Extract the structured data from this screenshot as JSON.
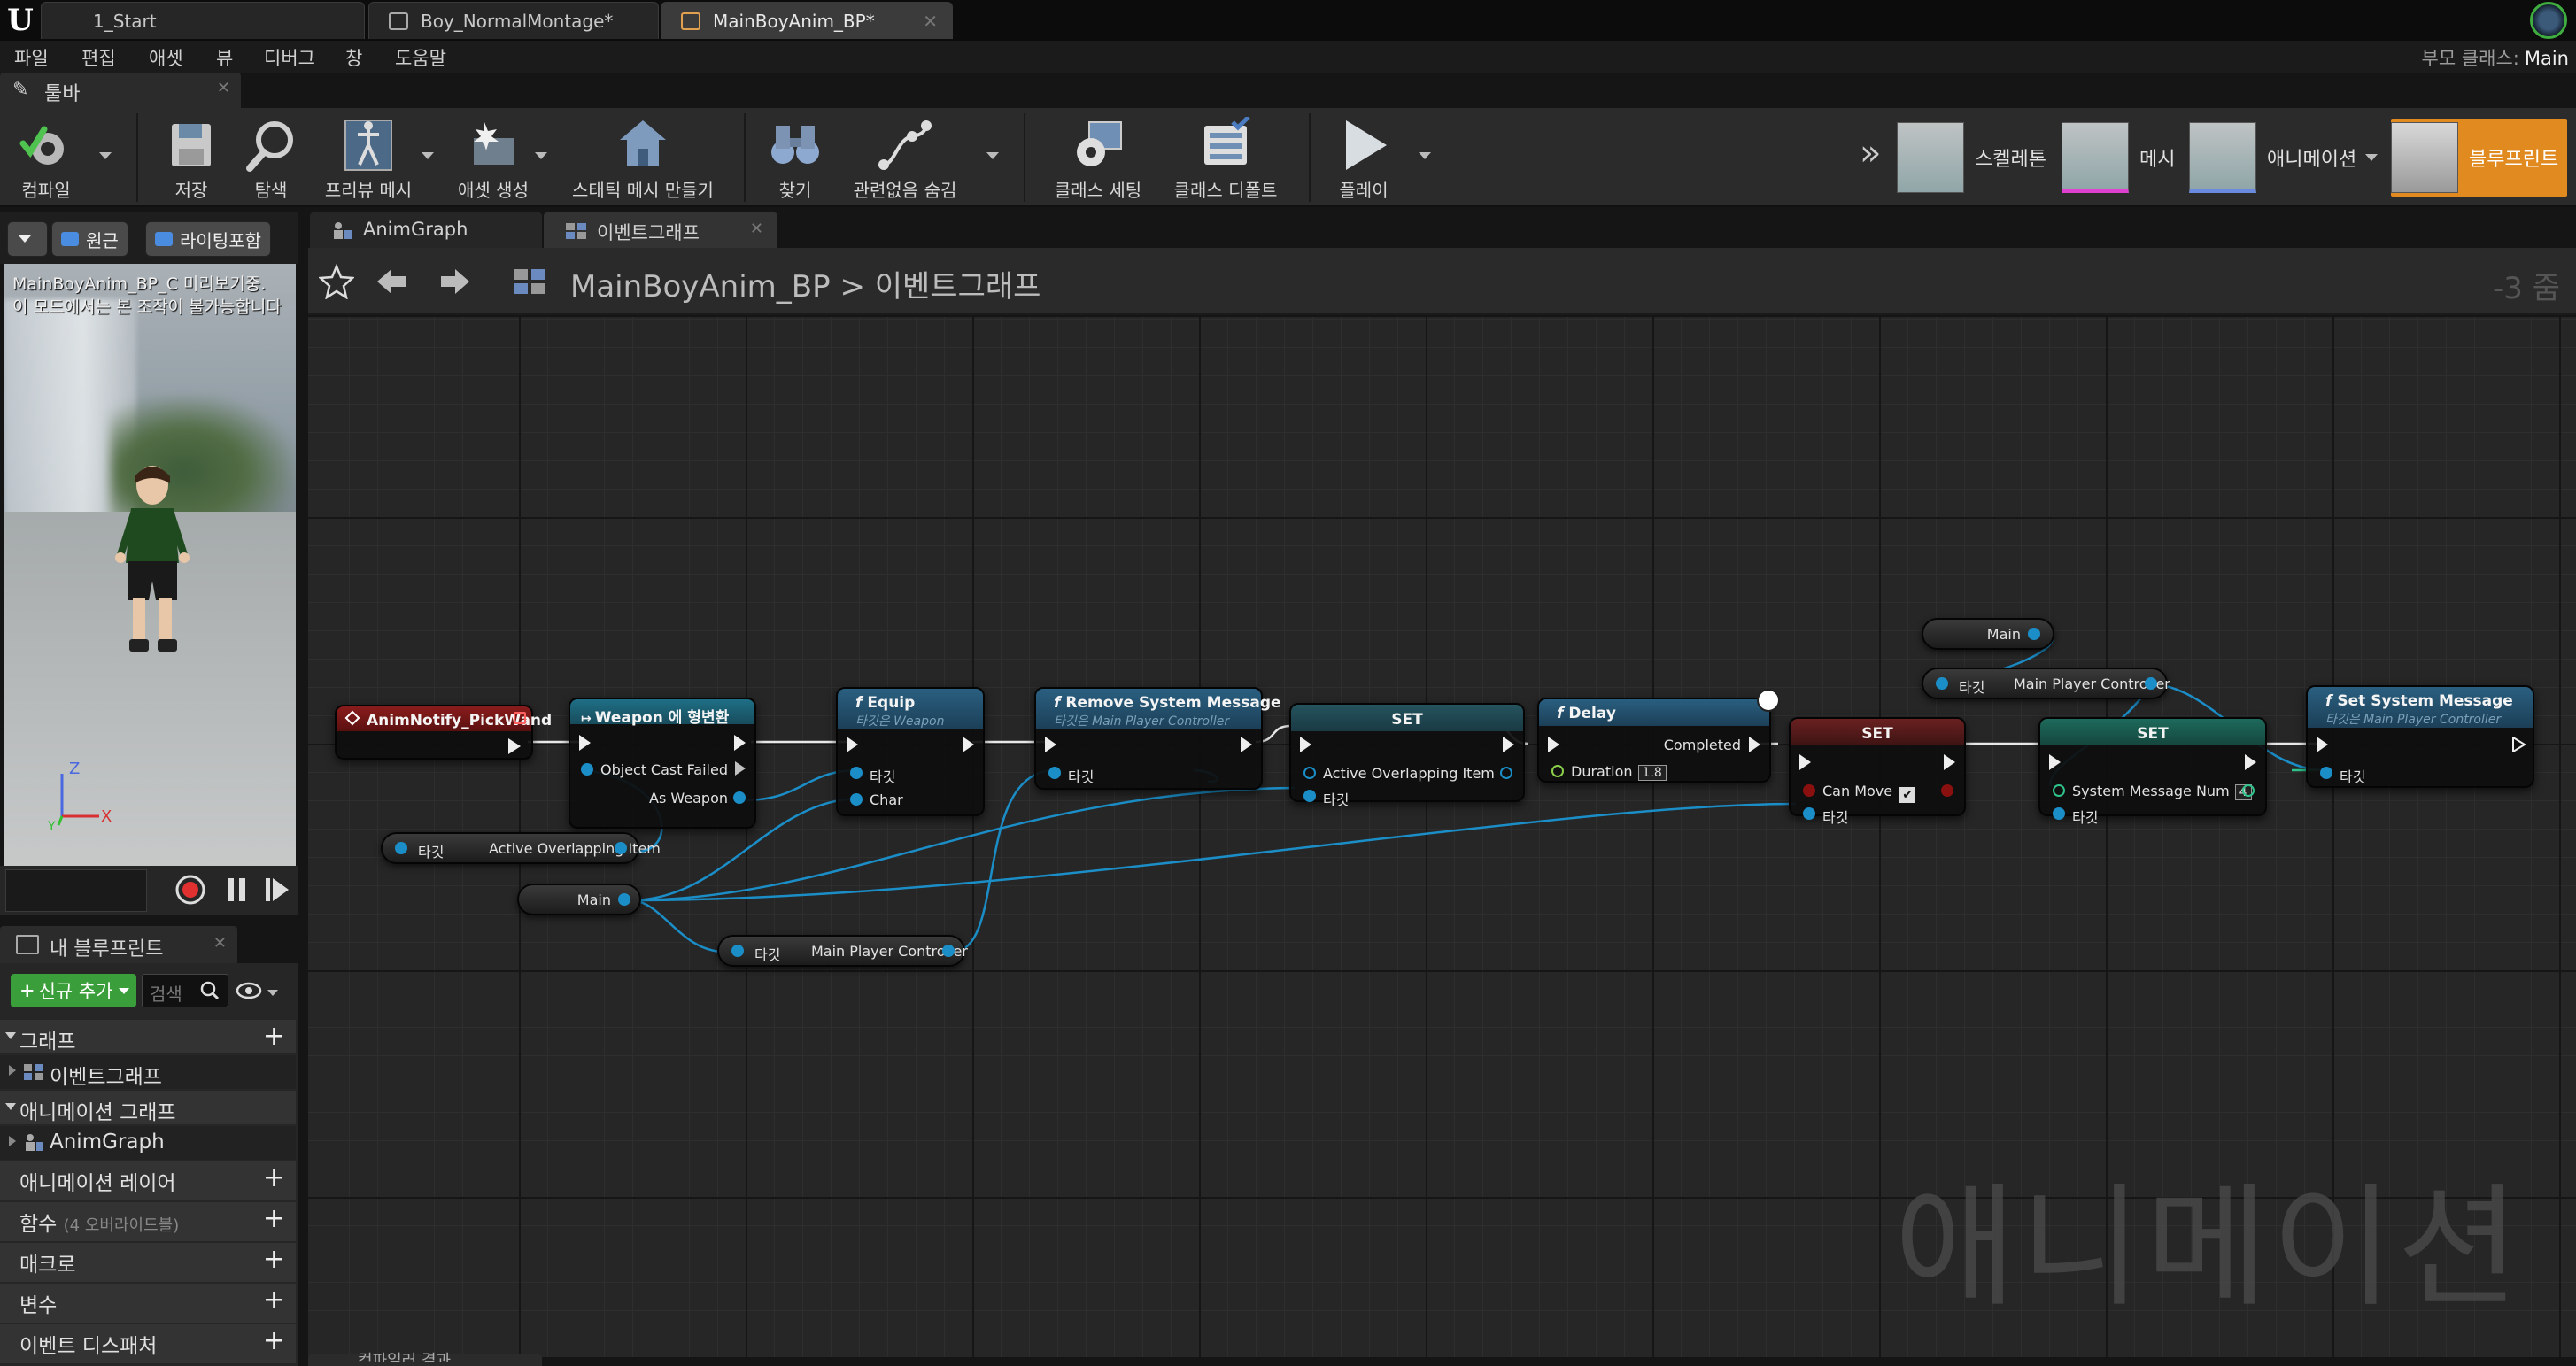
{
  "app": {
    "tabs": [
      {
        "label": "1_Start"
      },
      {
        "label": "Boy_NormalMontage*"
      },
      {
        "label": "MainBoyAnim_BP*"
      }
    ],
    "logo_text": "U"
  },
  "menu": {
    "items": [
      "파일",
      "편집",
      "애셋",
      "뷰",
      "디버그",
      "창",
      "도움말"
    ],
    "parent_class_label": "부모 클래스:",
    "parent_class_value": "Main"
  },
  "toolbar": {
    "tab_label": "툴바",
    "buttons": {
      "compile": "컴파일",
      "save": "저장",
      "browse": "탐색",
      "preview_mesh": "프리뷰 메시",
      "create_asset": "애셋 생성",
      "static_mesh": "스태틱 메시 만들기",
      "find": "찾기",
      "hide_unrelated": "관련없음 숨김",
      "class_settings": "클래스 세팅",
      "class_defaults": "클래스 디폴트",
      "play": "플레이"
    },
    "modes": {
      "skeleton": "스켈레톤",
      "mesh": "메시",
      "animation": "애니메이션",
      "blueprint": "블루프린트"
    },
    "overflow": "»"
  },
  "viewport": {
    "perspective": "원근",
    "lighting": "라이팅포함",
    "info_line1": "MainBoyAnim_BP_C 미리보기중.",
    "info_line2": "이 모드에서는 본 조작이 불가능합니다",
    "axis_x": "X",
    "axis_z": "Z",
    "axis_y": "Y"
  },
  "my_blueprint": {
    "tab_label": "내 블루프린트",
    "add_new": "신규 추가",
    "search_placeholder": "검색",
    "rows": {
      "graphs": "그래프",
      "event_graph": "이벤트그래프",
      "anim_graphs": "애니메이션 그래프",
      "anim_graph": "AnimGraph",
      "anim_layers": "애니메이션 레이어",
      "functions": "함수",
      "functions_note": "(4 오버라이드블)",
      "macros": "매크로",
      "variables": "변수",
      "dispatchers": "이벤트 디스패처"
    }
  },
  "graph_tabs": {
    "anim_graph": "AnimGraph",
    "event_graph": "이벤트그래프"
  },
  "graph_header": {
    "breadcrumb_root": "MainBoyAnim_BP",
    "breadcrumb_sep": ">",
    "breadcrumb_leaf": "이벤트그래프",
    "zoom": "-3 줌"
  },
  "nodes": {
    "anim_notify": {
      "title": "AnimNotify_PickWand"
    },
    "cast": {
      "title": "Weapon 에 형변환",
      "object": "Object",
      "cast_failed": "Cast Failed",
      "as_weapon": "As Weapon"
    },
    "equip": {
      "title": "Equip",
      "subtitle": "타깃은 Weapon",
      "target": "타깃",
      "char": "Char"
    },
    "remove_msg": {
      "title": "Remove System Message",
      "subtitle": "타깃은 Main Player Controller",
      "target": "타깃"
    },
    "set1": {
      "title": "SET",
      "pin1": "Active Overlapping Item",
      "target": "타깃"
    },
    "delay": {
      "title": "Delay",
      "completed": "Completed",
      "duration": "Duration",
      "duration_val": "1.8"
    },
    "set_can_move": {
      "title": "SET",
      "pin1": "Can Move",
      "check": "✔",
      "target": "타깃"
    },
    "set_msg_num": {
      "title": "SET",
      "pin1": "System Message Num",
      "val": "4",
      "target": "타깃"
    },
    "set_system_msg": {
      "title": "Set System Message",
      "subtitle": "타깃은 Main Player Controller",
      "target": "타깃"
    },
    "var_active_item": {
      "target": "타깃",
      "label": "Active Overlapping Item"
    },
    "var_main_1": {
      "label": "Main"
    },
    "var_mpc_1": {
      "target": "타깃",
      "label": "Main Player Controller"
    },
    "var_main_2": {
      "label": "Main"
    },
    "var_mpc_2": {
      "target": "타깃",
      "label": "Main Player Controller"
    }
  },
  "watermark": "애니메이션",
  "bottom_tab": "컴파일러 결과"
}
